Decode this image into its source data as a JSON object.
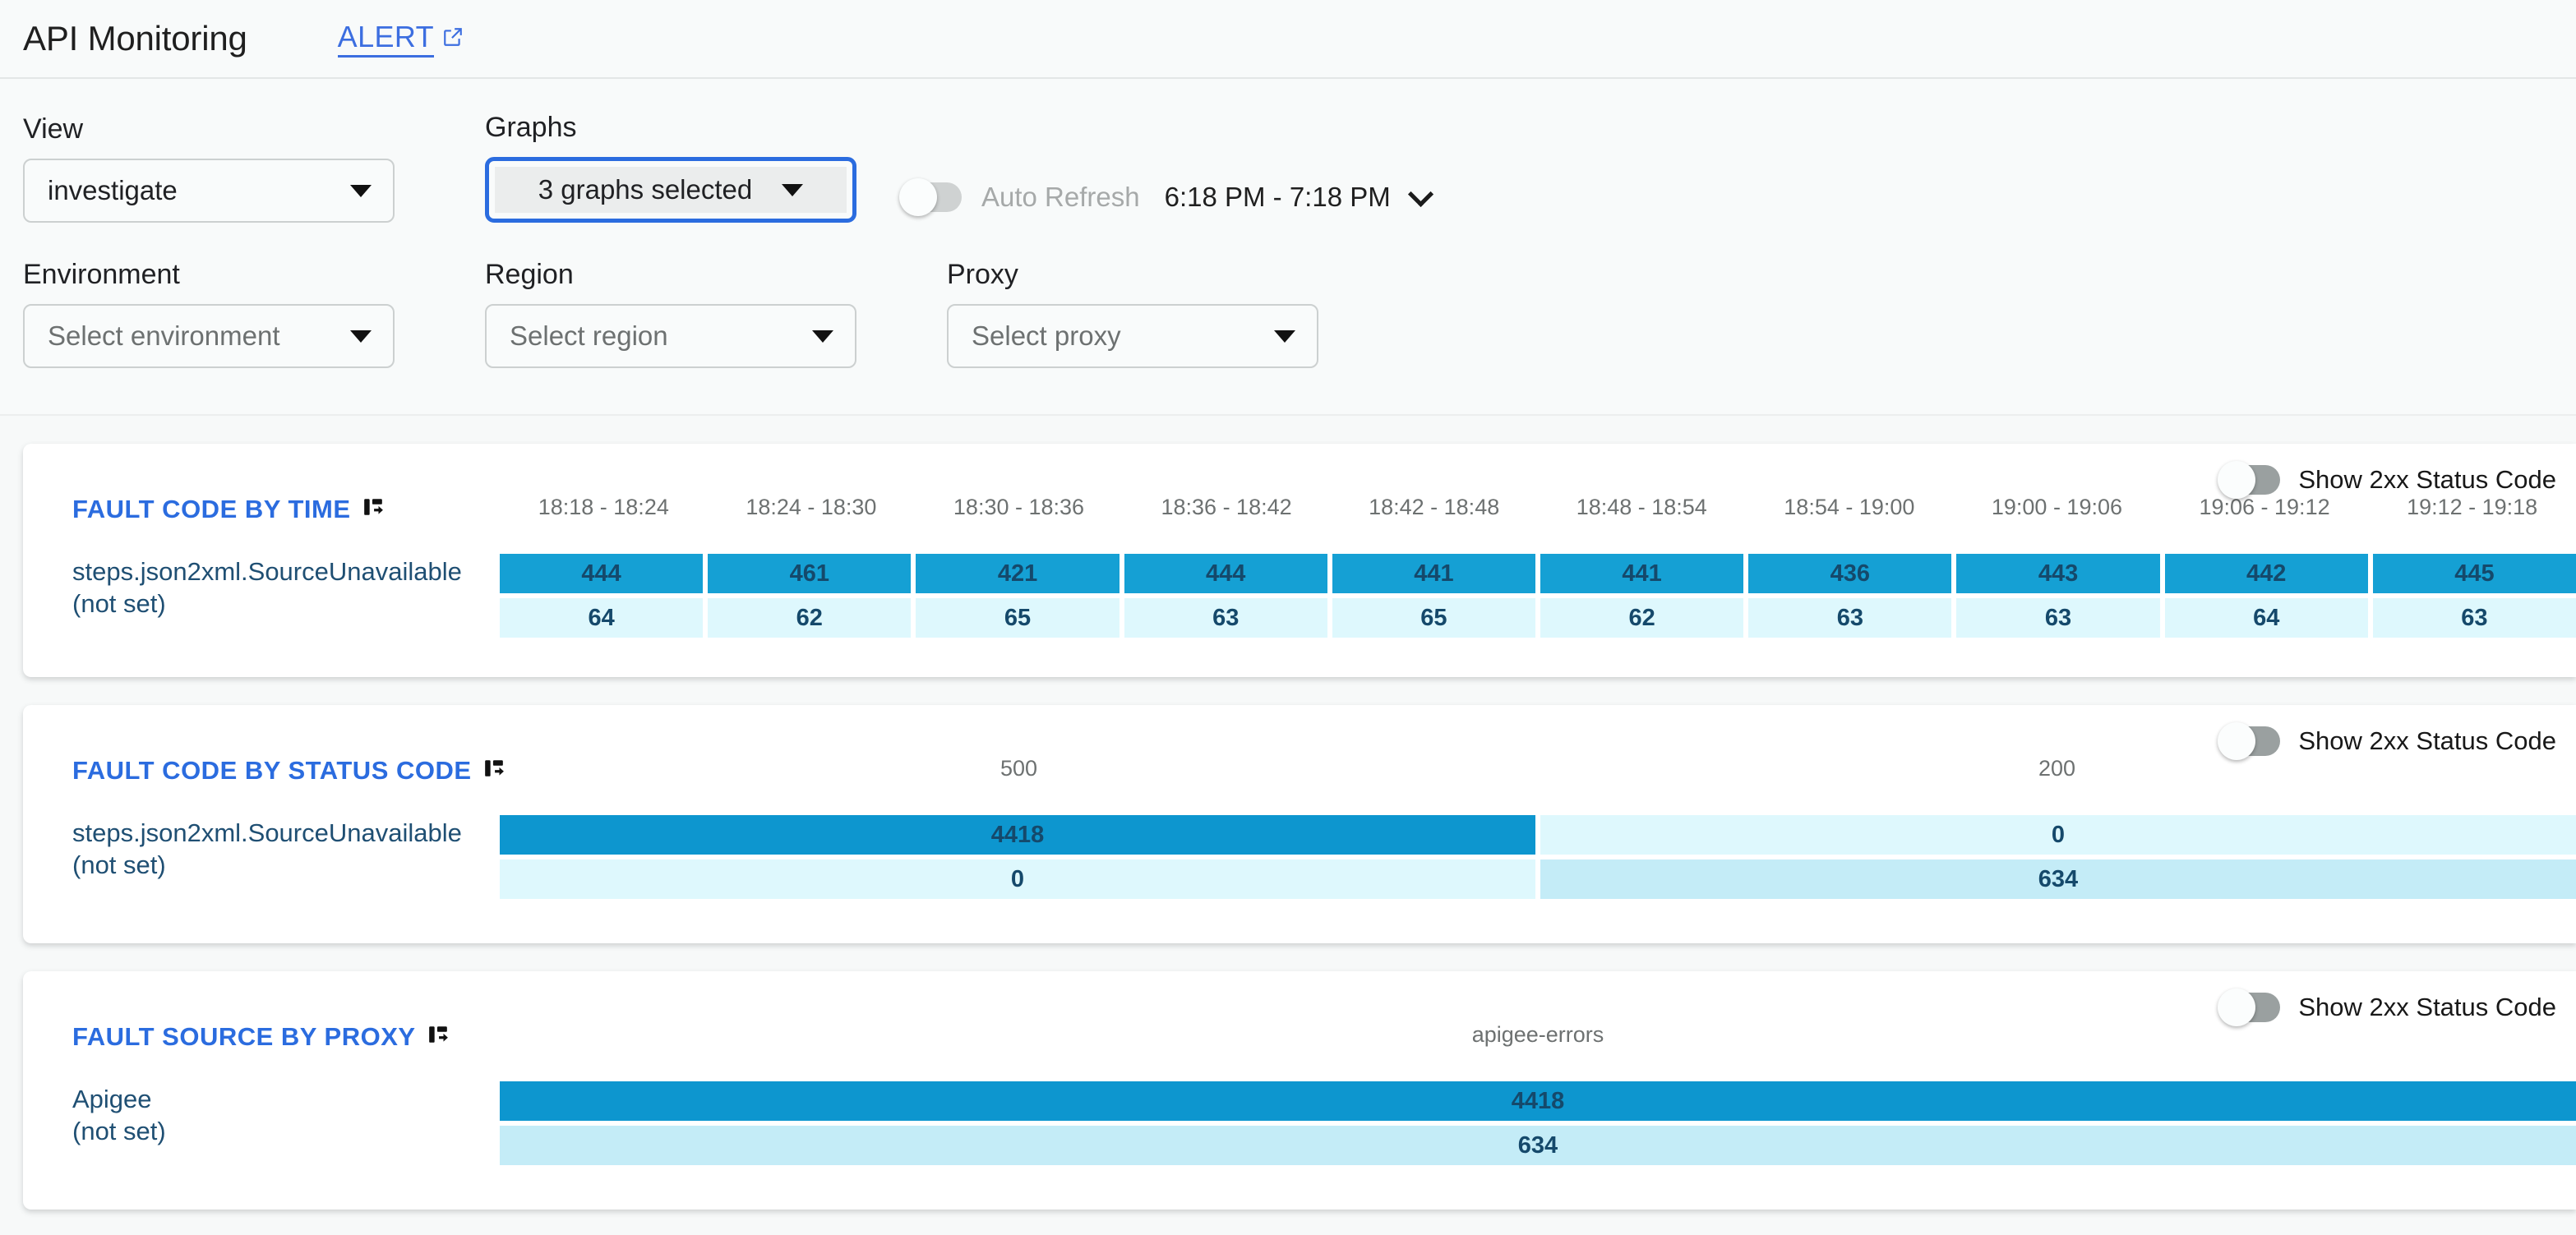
{
  "header": {
    "app_title": "API Monitoring",
    "alert_link": "ALERT",
    "external_link_icon": "external-link-icon"
  },
  "filters": {
    "view": {
      "label": "View",
      "value": "investigate"
    },
    "graphs": {
      "label": "Graphs",
      "value": "3 graphs selected"
    },
    "environment": {
      "label": "Environment",
      "placeholder": "Select environment"
    },
    "region": {
      "label": "Region",
      "placeholder": "Select region"
    },
    "proxy": {
      "label": "Proxy",
      "placeholder": "Select proxy"
    },
    "auto_refresh": {
      "label": "Auto Refresh",
      "enabled": false
    },
    "time_range": "6:18 PM - 7:18 PM"
  },
  "common": {
    "show_2xx_label": "Show 2xx Status Code",
    "pivot_icon": "pivot-swap-icon",
    "accent_blue": "#2b6cdf",
    "bar_primary": "#15a0d4",
    "bar_primary_dark": "#0d96cf",
    "bar_secondary": "#def8fd",
    "bar_secondary_dark": "#c4ecf7"
  },
  "chart_data": [
    {
      "id": "fault-code-by-time",
      "type": "heatmap",
      "title": "FAULT CODE BY TIME",
      "show_2xx": false,
      "categories": [
        "18:18 - 18:24",
        "18:24 - 18:30",
        "18:30 - 18:36",
        "18:36 - 18:42",
        "18:42 - 18:48",
        "18:48 - 18:54",
        "18:54 - 19:00",
        "19:00 - 19:06",
        "19:06 - 19:12",
        "19:12 - 19:18"
      ],
      "xlabel": "",
      "ylabel": "",
      "series": [
        {
          "name": "steps.json2xml.SourceUnavailable",
          "color": "#15a0d4",
          "values": [
            444,
            461,
            421,
            444,
            441,
            441,
            436,
            443,
            442,
            445
          ]
        },
        {
          "name": "(not set)",
          "color": "#def8fd",
          "values": [
            64,
            62,
            65,
            63,
            65,
            62,
            63,
            63,
            64,
            63
          ]
        }
      ]
    },
    {
      "id": "fault-code-by-status-code",
      "type": "heatmap",
      "title": "FAULT CODE BY STATUS CODE",
      "show_2xx": false,
      "categories": [
        "500",
        "200"
      ],
      "xlabel": "",
      "ylabel": "",
      "series": [
        {
          "name": "steps.json2xml.SourceUnavailable",
          "color": "#0d96cf",
          "values": [
            4418,
            0
          ]
        },
        {
          "name": "(not set)",
          "color": "#def8fd",
          "values": [
            0,
            634
          ]
        }
      ]
    },
    {
      "id": "fault-source-by-proxy",
      "type": "heatmap",
      "title": "FAULT SOURCE BY PROXY",
      "show_2xx": false,
      "categories": [
        "apigee-errors"
      ],
      "xlabel": "",
      "ylabel": "",
      "series": [
        {
          "name": "Apigee",
          "color": "#0d96cf",
          "values": [
            4418
          ]
        },
        {
          "name": "(not set)",
          "color": "#def8fd",
          "values": [
            634
          ]
        }
      ]
    }
  ]
}
